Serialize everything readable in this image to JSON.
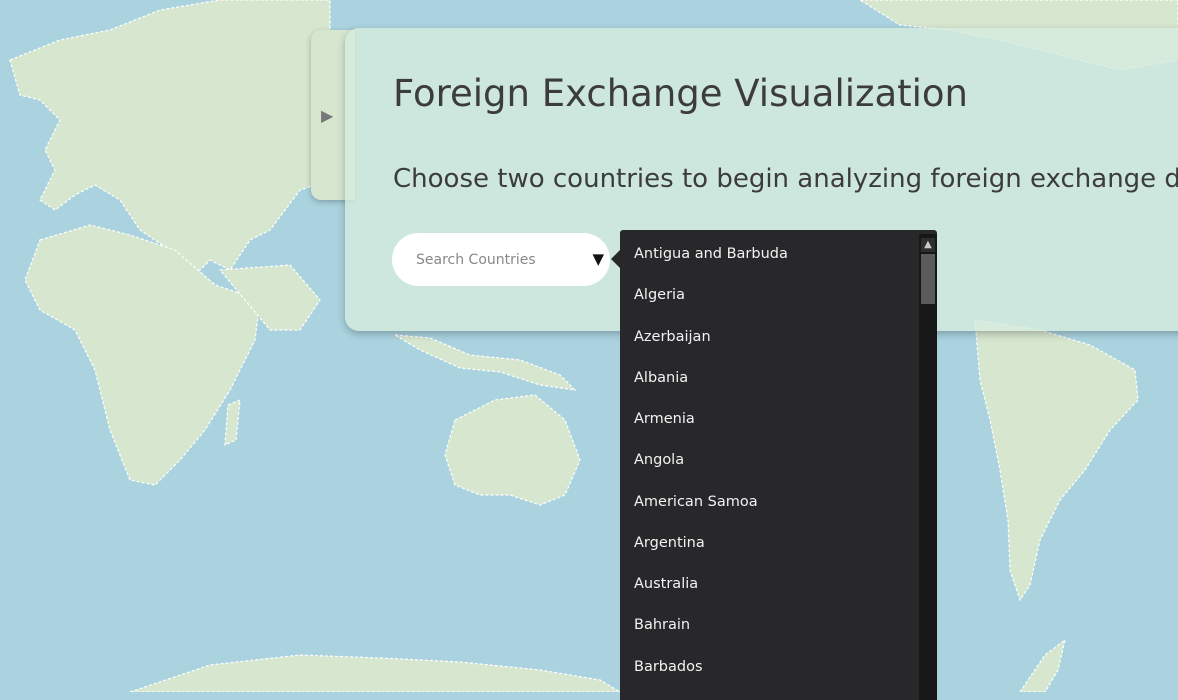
{
  "app": {
    "title": "Foreign Exchange Visualization",
    "subtitle": "Choose two countries to begin analyzing foreign exchange data"
  },
  "search": {
    "placeholder": "Search Countries",
    "dropdown_icon": "caret-down-icon"
  },
  "sidebar_toggle": {
    "icon": "triangle-right-icon"
  },
  "dropdown": {
    "options": [
      "Antigua and Barbuda",
      "Algeria",
      "Azerbaijan",
      "Albania",
      "Armenia",
      "Angola",
      "American Samoa",
      "Argentina",
      "Australia",
      "Bahrain",
      "Barbados"
    ]
  },
  "colors": {
    "water": "#aad3df",
    "land": "#d6e6cf",
    "panel": "#d6ecde",
    "dropdown_bg": "#28282b",
    "text": "#3c3c3c"
  }
}
